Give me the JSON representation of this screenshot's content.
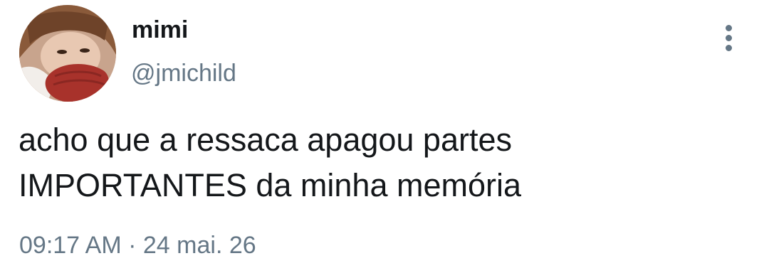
{
  "tweet": {
    "display_name": "mimi",
    "handle": "@jmichild",
    "text_line1": "acho que a ressaca apagou partes",
    "text_line2": "IMPORTANTES da minha memória",
    "time": "09:17 AM",
    "separator": "·",
    "date": "24 mai. 26",
    "avatar_icon": "user-avatar",
    "more_icon": "more-vertical-icon"
  },
  "colors": {
    "text_primary": "#14171a",
    "text_secondary": "#657786",
    "background": "#ffffff"
  }
}
